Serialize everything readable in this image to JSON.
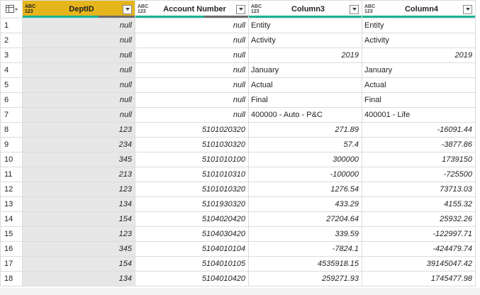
{
  "columns": [
    {
      "type": "ABC 123",
      "type_top": "ABC",
      "type_bottom": "123",
      "name": "DeptID",
      "selected": true,
      "valid_pct": 0.68
    },
    {
      "type_top": "ABC",
      "type_bottom": "123",
      "name": "Account Number",
      "selected": false,
      "valid_pct": 0.61
    },
    {
      "type_top": "ABC",
      "type_bottom": "123",
      "name": "Column3",
      "selected": false,
      "valid_pct": 1.0
    },
    {
      "type_top": "ABC",
      "type_bottom": "123",
      "name": "Column4",
      "selected": false,
      "valid_pct": 1.0
    }
  ],
  "rows": [
    {
      "n": "1",
      "c1": "null",
      "c2": "null",
      "c3": "Entity",
      "c4": "Entity"
    },
    {
      "n": "2",
      "c1": "null",
      "c2": "null",
      "c3": "Activity",
      "c4": "Activity"
    },
    {
      "n": "3",
      "c1": "null",
      "c2": "null",
      "c3": "2019",
      "c4": "2019"
    },
    {
      "n": "4",
      "c1": "null",
      "c2": "null",
      "c3": "January",
      "c4": "January"
    },
    {
      "n": "5",
      "c1": "null",
      "c2": "null",
      "c3": "Actual",
      "c4": "Actual"
    },
    {
      "n": "6",
      "c1": "null",
      "c2": "null",
      "c3": "Final",
      "c4": "Final"
    },
    {
      "n": "7",
      "c1": "null",
      "c2": "null",
      "c3": "400000 - Auto - P&C",
      "c4": "400001 - Life"
    },
    {
      "n": "8",
      "c1": "123",
      "c2": "5101020320",
      "c3": "271.89",
      "c4": "-16091.44"
    },
    {
      "n": "9",
      "c1": "234",
      "c2": "5101030320",
      "c3": "57.4",
      "c4": "-3877.86"
    },
    {
      "n": "10",
      "c1": "345",
      "c2": "5101010100",
      "c3": "300000",
      "c4": "1739150"
    },
    {
      "n": "11",
      "c1": "213",
      "c2": "5101010310",
      "c3": "-100000",
      "c4": "-725500"
    },
    {
      "n": "12",
      "c1": "123",
      "c2": "5101010320",
      "c3": "1276.54",
      "c4": "73713.03"
    },
    {
      "n": "13",
      "c1": "134",
      "c2": "5101930320",
      "c3": "433.29",
      "c4": "4155.32"
    },
    {
      "n": "14",
      "c1": "154",
      "c2": "5104020420",
      "c3": "27204.64",
      "c4": "25932.26"
    },
    {
      "n": "15",
      "c1": "123",
      "c2": "5104030420",
      "c3": "339.59",
      "c4": "-122997.71"
    },
    {
      "n": "16",
      "c1": "345",
      "c2": "5104010104",
      "c3": "-7824.1",
      "c4": "-424479.74"
    },
    {
      "n": "17",
      "c1": "154",
      "c2": "5104010105",
      "c3": "4535918.15",
      "c4": "39145047.42"
    },
    {
      "n": "18",
      "c1": "134",
      "c2": "5104010420",
      "c3": "259271.93",
      "c4": "1745477.98"
    }
  ],
  "cell_align": {
    "c3_text_rows": [
      "1",
      "2",
      "4",
      "5",
      "6",
      "7"
    ],
    "c4_text_rows": [
      "1",
      "2",
      "4",
      "5",
      "6",
      "7"
    ]
  },
  "colors": {
    "selected_header": "#e6b51b",
    "quality_valid": "#1ab394",
    "quality_empty": "#6b6b6b",
    "selected_column_bg": "#e7e7e7"
  },
  "icons": {
    "table_menu": "table-icon",
    "column_type": "any-type-icon",
    "column_filter": "chevron-down-icon"
  }
}
